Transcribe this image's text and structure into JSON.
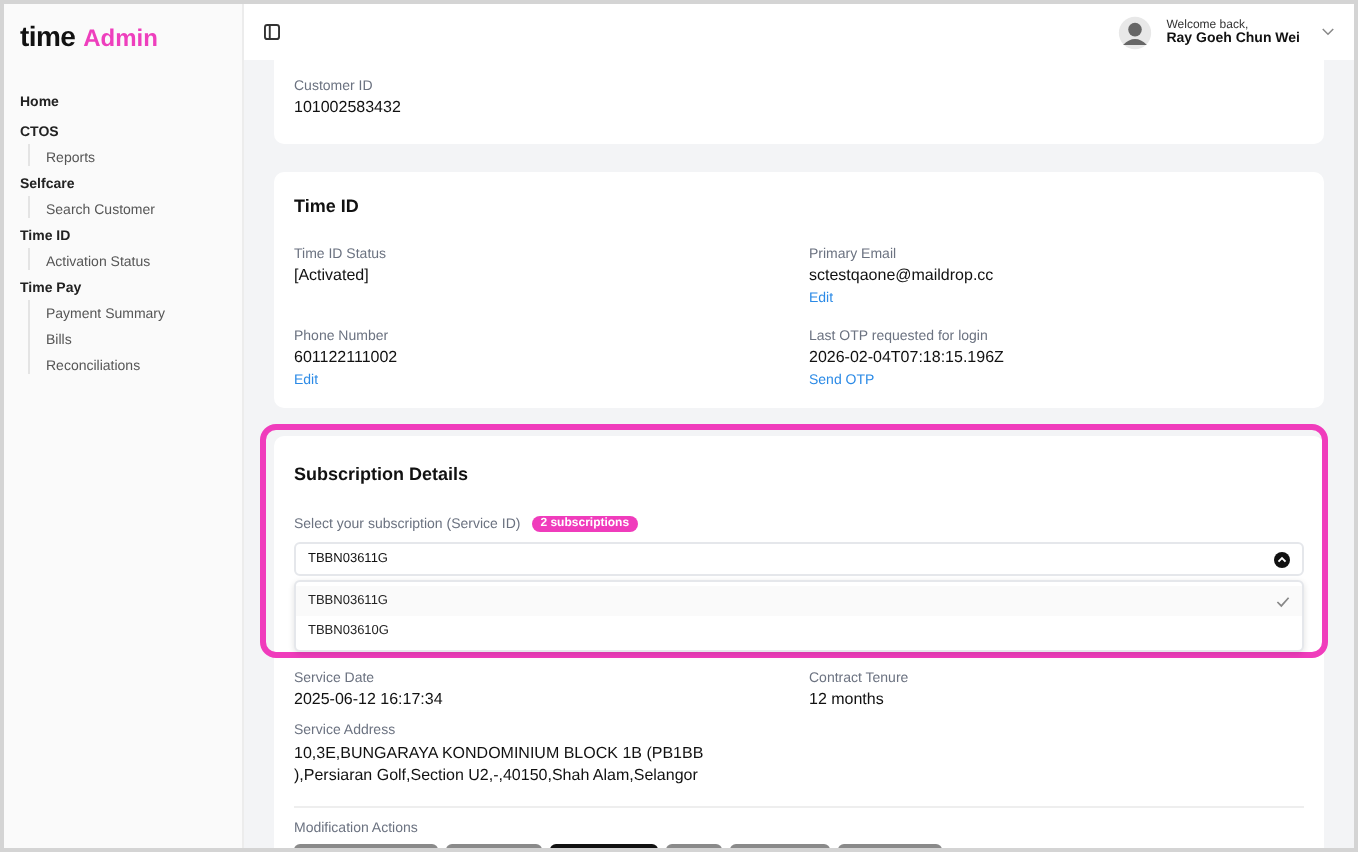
{
  "brand": {
    "name": "time",
    "suffix": "Admin"
  },
  "sidebar": {
    "sections": [
      {
        "label": "Home"
      },
      {
        "label": "CTOS",
        "children": [
          {
            "label": "Reports"
          }
        ]
      },
      {
        "label": "Selfcare",
        "children": [
          {
            "label": "Search Customer"
          }
        ]
      },
      {
        "label": "Time ID",
        "children": [
          {
            "label": "Activation Status"
          }
        ]
      },
      {
        "label": "Time Pay",
        "children": [
          {
            "label": "Payment Summary"
          },
          {
            "label": "Bills"
          },
          {
            "label": "Reconciliations"
          }
        ]
      }
    ]
  },
  "header": {
    "greeting": "Welcome back,",
    "user_name": "Ray Goeh Chun Wei"
  },
  "customer_card": {
    "label": "Customer ID",
    "value": "101002583432"
  },
  "time_id_card": {
    "title": "Time ID",
    "fields": [
      {
        "label": "Time ID Status",
        "value": "[Activated]"
      },
      {
        "label": "Primary Email",
        "value": "sctestqaone@maildrop.cc",
        "link": "Edit"
      },
      {
        "label": "Phone Number",
        "value": "601122111002",
        "link": "Edit"
      },
      {
        "label": "Last OTP requested for login",
        "value": "2026-02-04T07:18:15.196Z",
        "link": "Send OTP"
      }
    ]
  },
  "subscription_card": {
    "title": "Subscription Details",
    "select_label": "Select your subscription (Service ID)",
    "badge": "2 subscriptions",
    "select_value": "TBBN03611G",
    "expanded": true,
    "options": [
      {
        "label": "TBBN03611G",
        "selected": true
      },
      {
        "label": "TBBN03610G",
        "selected": false
      }
    ],
    "fields": [
      {
        "label": "Service Date",
        "value": "2025-06-12 16:17:34"
      },
      {
        "label": "Contract Tenure",
        "value": "12 months"
      }
    ],
    "address_label": "Service Address",
    "address": "10,3E,BUNGARAYA KONDOMINIUM BLOCK 1B (PB1BB ),Persiaran Golf,Section U2,-,40150,Shah Alam,Selangor",
    "actions_label": "Modification Actions",
    "actions": [
      {
        "selected": false
      },
      {
        "selected": false
      },
      {
        "selected": true
      },
      {
        "selected": false
      },
      {
        "selected": false
      },
      {
        "selected": false
      }
    ]
  }
}
